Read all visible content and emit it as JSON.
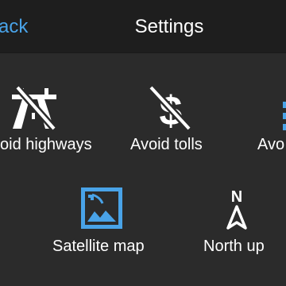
{
  "header": {
    "back_label": "ack",
    "title": "Settings"
  },
  "options": {
    "avoid_highways": {
      "label": "oid highways",
      "icon": "highway-crossed-icon",
      "selected": false
    },
    "avoid_tolls": {
      "label": "Avoid tolls",
      "icon": "dollar-crossed-icon",
      "selected": false
    },
    "avoid_partial": {
      "label": "Avo",
      "icon": "partial-icon",
      "selected": false
    },
    "satellite_map": {
      "label": "Satellite map",
      "icon": "satellite-map-icon",
      "selected": true
    },
    "north_up": {
      "label": "North up",
      "icon": "north-arrow-icon",
      "north_letter": "N",
      "selected": false
    }
  },
  "colors": {
    "accent": "#49a3e8",
    "background": "#2b2b2b",
    "header_background": "#1e1e1e",
    "text": "#ffffff"
  }
}
